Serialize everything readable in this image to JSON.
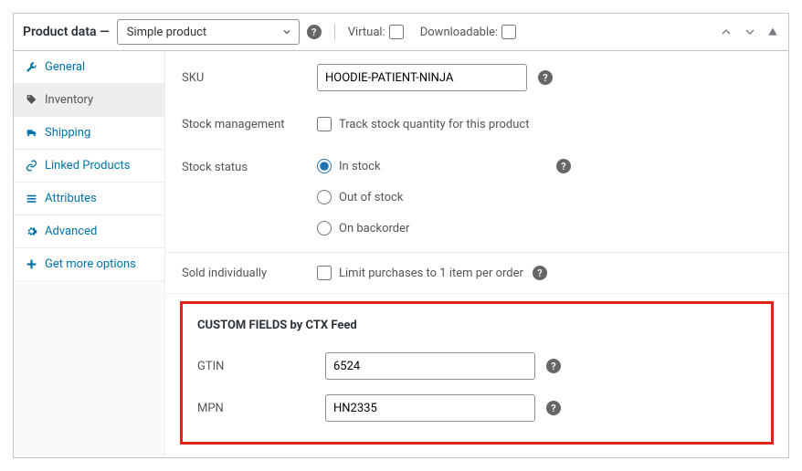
{
  "header": {
    "title": "Product data —",
    "product_type_selected": "Simple product",
    "virtual_label": "Virtual:",
    "downloadable_label": "Downloadable:"
  },
  "sidebar": {
    "items": [
      {
        "label": "General"
      },
      {
        "label": "Inventory"
      },
      {
        "label": "Shipping"
      },
      {
        "label": "Linked Products"
      },
      {
        "label": "Attributes"
      },
      {
        "label": "Advanced"
      },
      {
        "label": "Get more options"
      }
    ]
  },
  "sku": {
    "label": "SKU",
    "value": "HOODIE-PATIENT-NINJA"
  },
  "stock_mgmt": {
    "label": "Stock management",
    "checkbox_label": "Track stock quantity for this product"
  },
  "stock_status": {
    "label": "Stock status",
    "options": {
      "in_stock": "In stock",
      "out_of_stock": "Out of stock",
      "on_backorder": "On backorder"
    }
  },
  "sold_individually": {
    "label": "Sold individually",
    "checkbox_label": "Limit purchases to 1 item per order"
  },
  "custom_fields": {
    "title": "CUSTOM FIELDS by CTX Feed",
    "gtin": {
      "label": "GTIN",
      "value": "6524"
    },
    "mpn": {
      "label": "MPN",
      "value": "HN2335"
    }
  }
}
